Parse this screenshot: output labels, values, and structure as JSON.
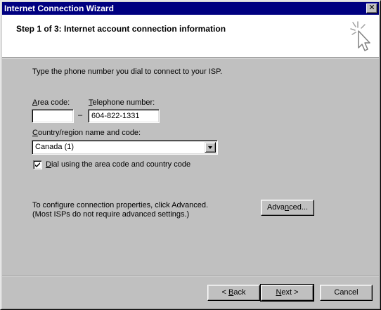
{
  "window": {
    "title": "Internet Connection Wizard",
    "close_glyph": "✕"
  },
  "header": {
    "step_title": "Step 1 of 3: Internet account connection information",
    "icon": "wizard-cursor-icon"
  },
  "form": {
    "instruction": "Type the phone number you dial to connect to your ISP.",
    "area_code": {
      "label_mnemonic": "A",
      "label_rest": "rea code:",
      "value": ""
    },
    "dash": "–",
    "telephone": {
      "label_mnemonic": "T",
      "label_rest": "elephone number:",
      "value": "604-822-1331"
    },
    "country": {
      "label_mnemonic": "C",
      "label_rest": "ountry/region name and code:",
      "selected": "Canada (1)"
    },
    "dial_checkbox": {
      "checked": true,
      "label_mnemonic": "D",
      "label_rest": "ial using the area code and country code"
    },
    "advanced_info_line1": "To configure connection properties, click Advanced.",
    "advanced_info_line2": "(Most ISPs do not require advanced settings.)",
    "advanced_button": {
      "pre": "Adva",
      "mnemonic": "n",
      "post": "ced..."
    }
  },
  "footer": {
    "back_button": {
      "pre": "< ",
      "mnemonic": "B",
      "post": "ack"
    },
    "next_button": {
      "mnemonic": "N",
      "post": "ext >"
    },
    "cancel_button": {
      "label": "Cancel"
    }
  },
  "colors": {
    "titlebar": "#000080",
    "face": "#c0c0c0",
    "header_bg": "#ffffff"
  }
}
